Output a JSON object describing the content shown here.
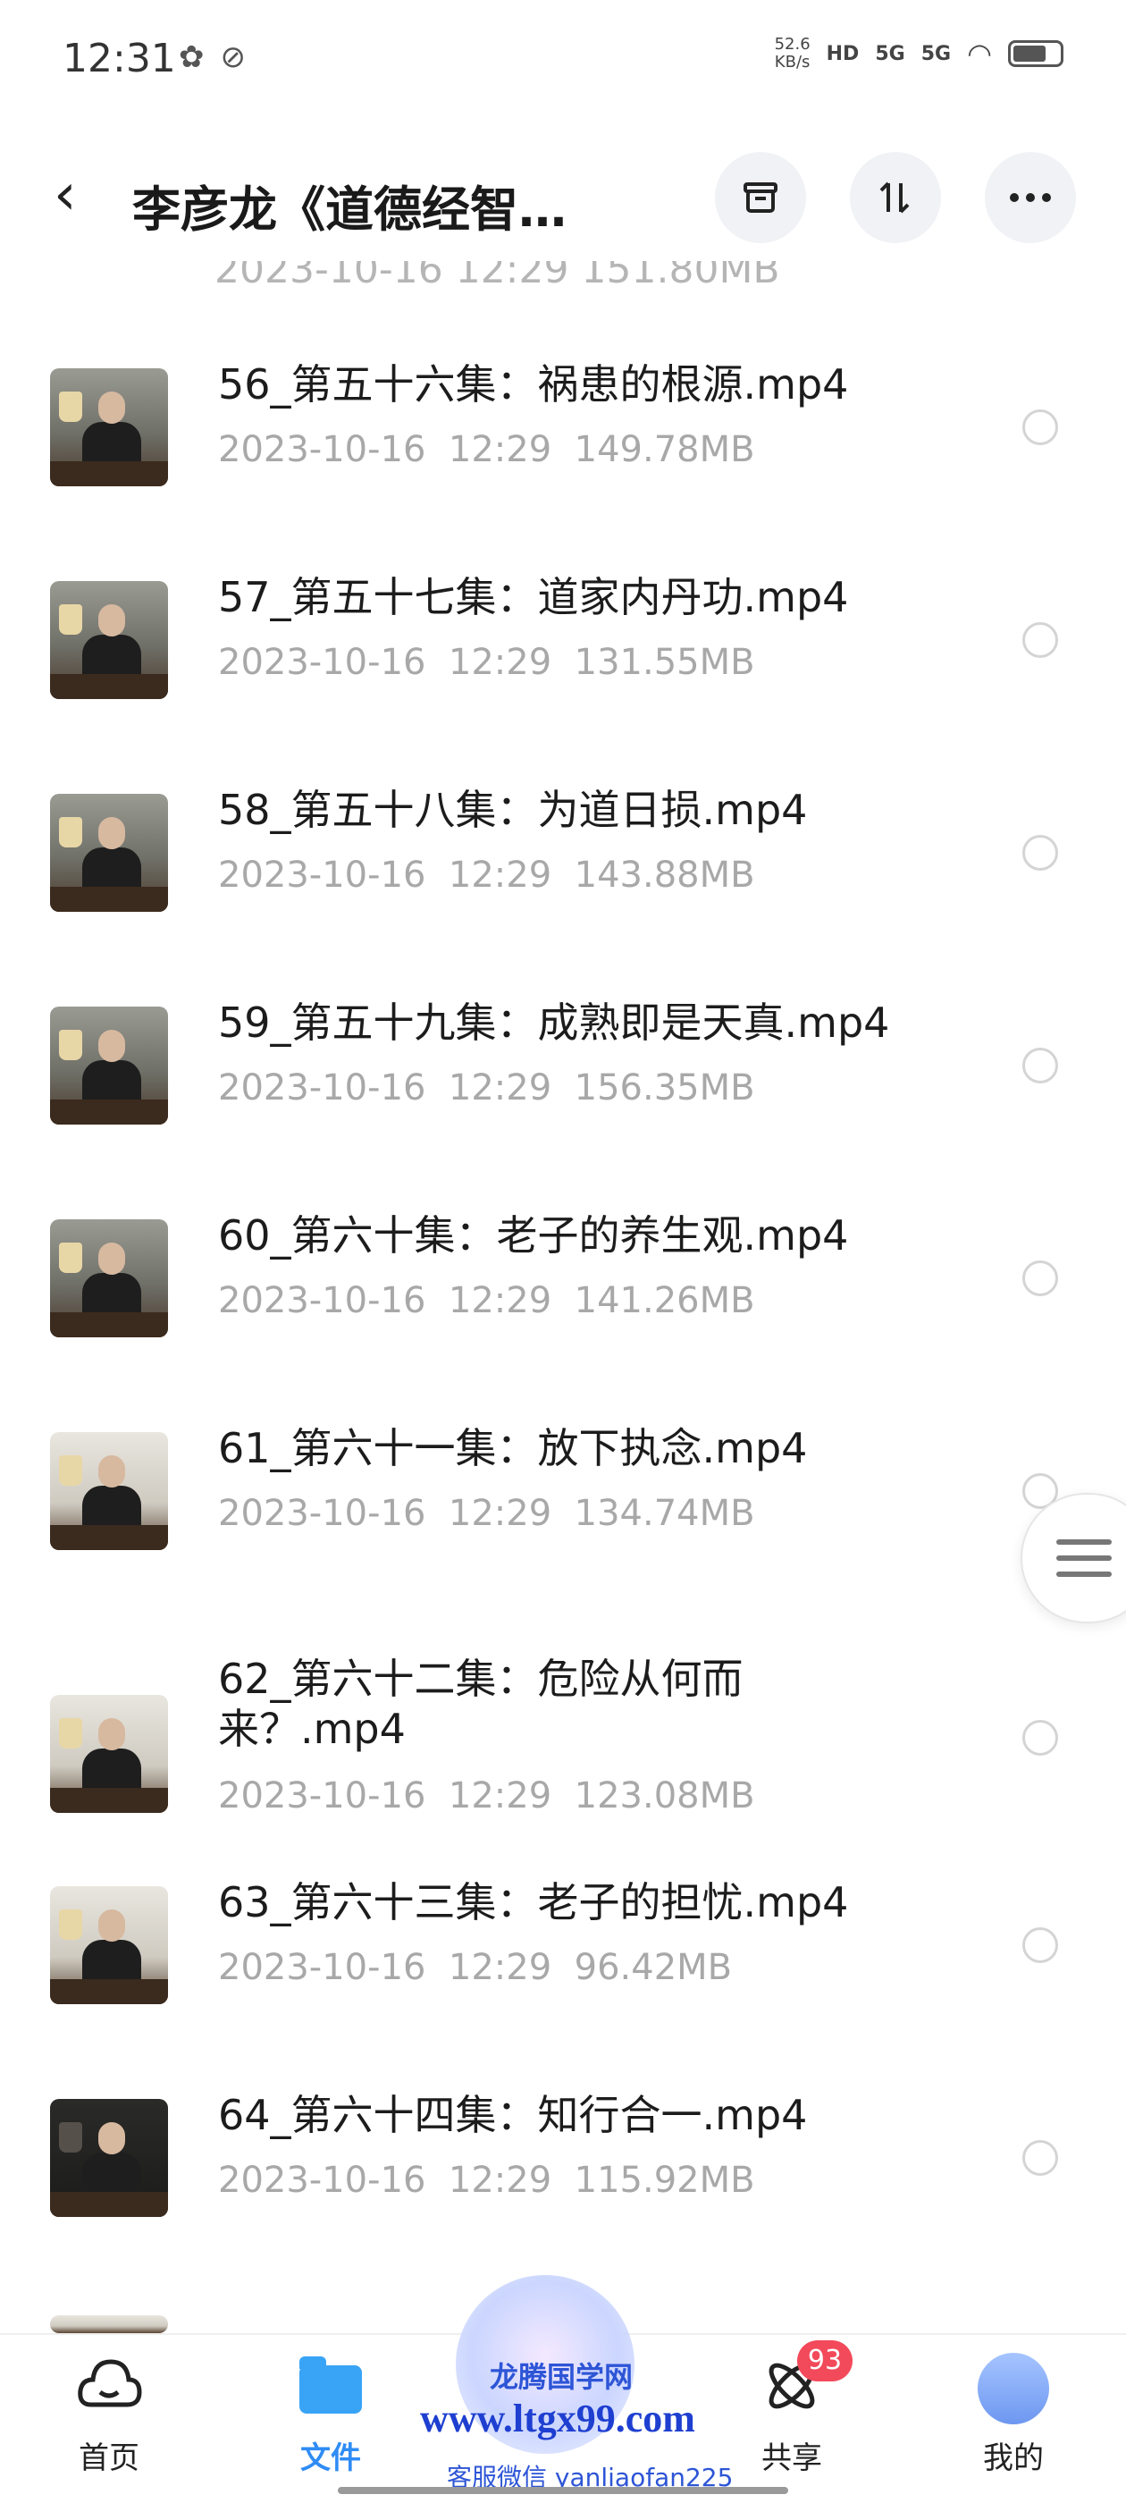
{
  "status_bar": {
    "time": "12:31",
    "left_icons": [
      "wechat-icon",
      "leaf-icon"
    ],
    "net_speed_value": "52.6",
    "net_speed_unit": "KB/s",
    "hd_label": "HD",
    "sim1": "5G",
    "sim2": "5G"
  },
  "header": {
    "title": "李彦龙《道德经智…",
    "buttons": [
      "archive-icon",
      "sort-icon",
      "more-icon"
    ]
  },
  "files": [
    {
      "name": "56_第五十六集：祸患的根源.mp4",
      "date": "2023-10-16",
      "time": "12:29",
      "size": "149.78MB",
      "thumb": "normal"
    },
    {
      "name": "57_第五十七集：道家内丹功.mp4",
      "date": "2023-10-16",
      "time": "12:29",
      "size": "131.55MB",
      "thumb": "normal"
    },
    {
      "name": "58_第五十八集：为道日损.mp4",
      "date": "2023-10-16",
      "time": "12:29",
      "size": "143.88MB",
      "thumb": "normal"
    },
    {
      "name": "59_第五十九集：成熟即是天真.mp4",
      "date": "2023-10-16",
      "time": "12:29",
      "size": "156.35MB",
      "thumb": "normal"
    },
    {
      "name": "60_第六十集：老子的养生观.mp4",
      "date": "2023-10-16",
      "time": "12:29",
      "size": "141.26MB",
      "thumb": "normal"
    },
    {
      "name": "61_第六十一集：放下执念.mp4",
      "date": "2023-10-16",
      "time": "12:29",
      "size": "134.74MB",
      "thumb": "light"
    },
    {
      "name": "62_第六十二集：危险从何而来？.mp4",
      "date": "2023-10-16",
      "time": "12:29",
      "size": "123.08MB",
      "thumb": "light"
    },
    {
      "name": "63_第六十三集：老子的担忧.mp4",
      "date": "2023-10-16",
      "time": "12:29",
      "size": "96.42MB",
      "thumb": "light"
    },
    {
      "name": "64_第六十四集：知行合一.mp4",
      "date": "2023-10-16",
      "time": "12:29",
      "size": "115.92MB",
      "thumb": "dark"
    }
  ],
  "bottom_nav": {
    "items": [
      {
        "label": "首页",
        "icon": "cloud-icon"
      },
      {
        "label": "文件",
        "icon": "folder-icon",
        "active": true
      },
      {
        "label": "",
        "icon": "mascot-icon"
      },
      {
        "label": "共享",
        "icon": "atom-icon",
        "badge": "93"
      },
      {
        "label": "我的",
        "icon": "avatar-icon"
      }
    ]
  },
  "watermark": {
    "line1": "龙腾国学网",
    "line2": "www.ltgx99.com",
    "line3": "客服微信 yanliaofan225"
  },
  "colors": {
    "accent": "#2f8cf5",
    "badge": "#f24a5a",
    "meta_text": "#a8a8a8"
  }
}
